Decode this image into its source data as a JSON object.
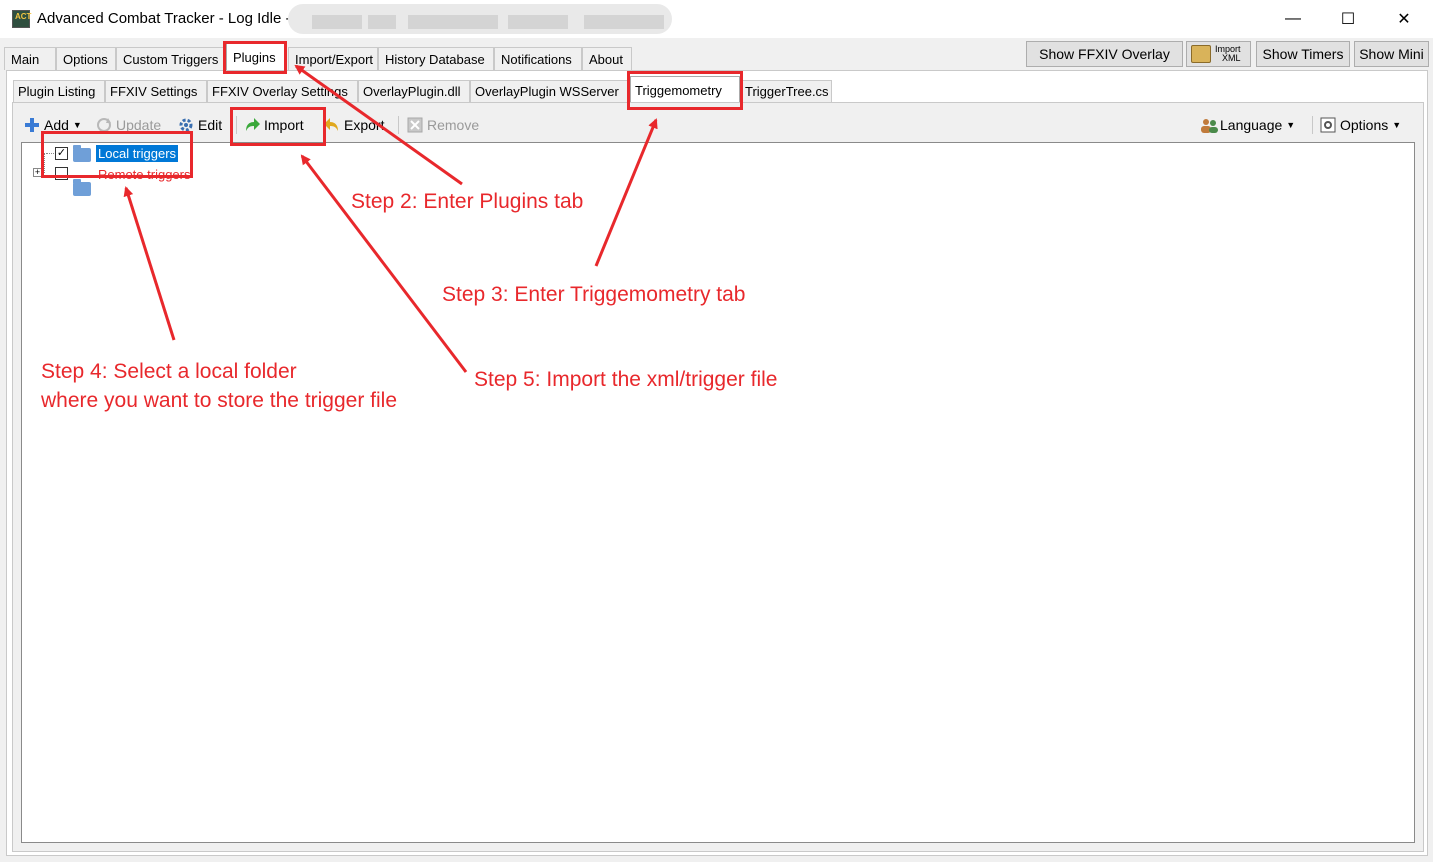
{
  "window": {
    "title": "Advanced Combat Tracker - Log Idle -",
    "controls": {
      "minimize": "—",
      "maximize": "☐",
      "close": "✕"
    }
  },
  "main_tabs": [
    "Main",
    "Options",
    "Custom Triggers",
    "Plugins",
    "Import/Export",
    "History Database",
    "Notifications",
    "About"
  ],
  "active_main_tab": "Plugins",
  "right_buttons": {
    "show_overlay": "Show FFXIV Overlay",
    "import_xml_top": "Import",
    "import_xml_bottom": "XML",
    "show_timers": "Show Timers",
    "show_mini": "Show Mini"
  },
  "sub_tabs": [
    "Plugin Listing",
    "FFXIV Settings",
    "FFXIV Overlay Settings",
    "OverlayPlugin.dll",
    "OverlayPlugin WSServer",
    "Triggemometry",
    "TriggerTree.cs"
  ],
  "active_sub_tab": "Triggemometry",
  "toolbar": {
    "add": "Add",
    "update": "Update",
    "edit": "Edit",
    "import": "Import",
    "export": "Export",
    "remove": "Remove",
    "language": "Language",
    "options": "Options"
  },
  "tree": {
    "local": "Local triggers",
    "remote": "Remote triggers"
  },
  "annotations": {
    "step2": "Step 2: Enter Plugins tab",
    "step3": "Step 3: Enter Triggemometry tab",
    "step4_line1": "Step 4: Select a local folder",
    "step4_line2": "where you want to store the trigger file",
    "step5": "Step 5: Import the xml/trigger file"
  },
  "colors": {
    "annotation": "#e8282c",
    "selection": "#0078d7"
  }
}
